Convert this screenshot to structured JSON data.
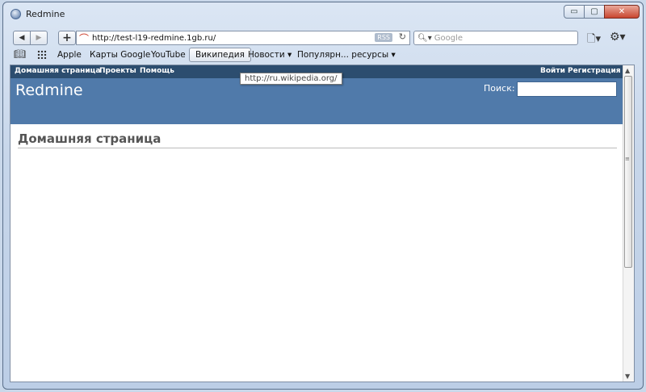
{
  "window": {
    "title": "Redmine"
  },
  "controls": {
    "minimize": "▭",
    "maximize": "▢",
    "close": "✕"
  },
  "nav": {
    "back": "◀",
    "forward": "▶",
    "add": "+"
  },
  "address": {
    "url": "http://test-l19-redmine.1gb.ru/",
    "rss": "RSS",
    "reload": "↻"
  },
  "search": {
    "placeholder": "Google"
  },
  "bookmarks": [
    "Apple",
    "Карты Google",
    "YouTube",
    "Википедия",
    "Новости ▾",
    "Популярн... ресурсы ▾"
  ],
  "tooltip": "http://ru.wikipedia.org/",
  "redmine": {
    "top_menu_left": [
      "Домашняя страница",
      "Проекты",
      "Помощь"
    ],
    "top_menu_right": [
      "Войти",
      "Регистрация"
    ],
    "logo": "Redmine",
    "search_label": "Поиск:",
    "page_title": "Домашняя страница"
  },
  "colors": {
    "top_menu": "#2c4d6f",
    "header": "#507aaa"
  }
}
